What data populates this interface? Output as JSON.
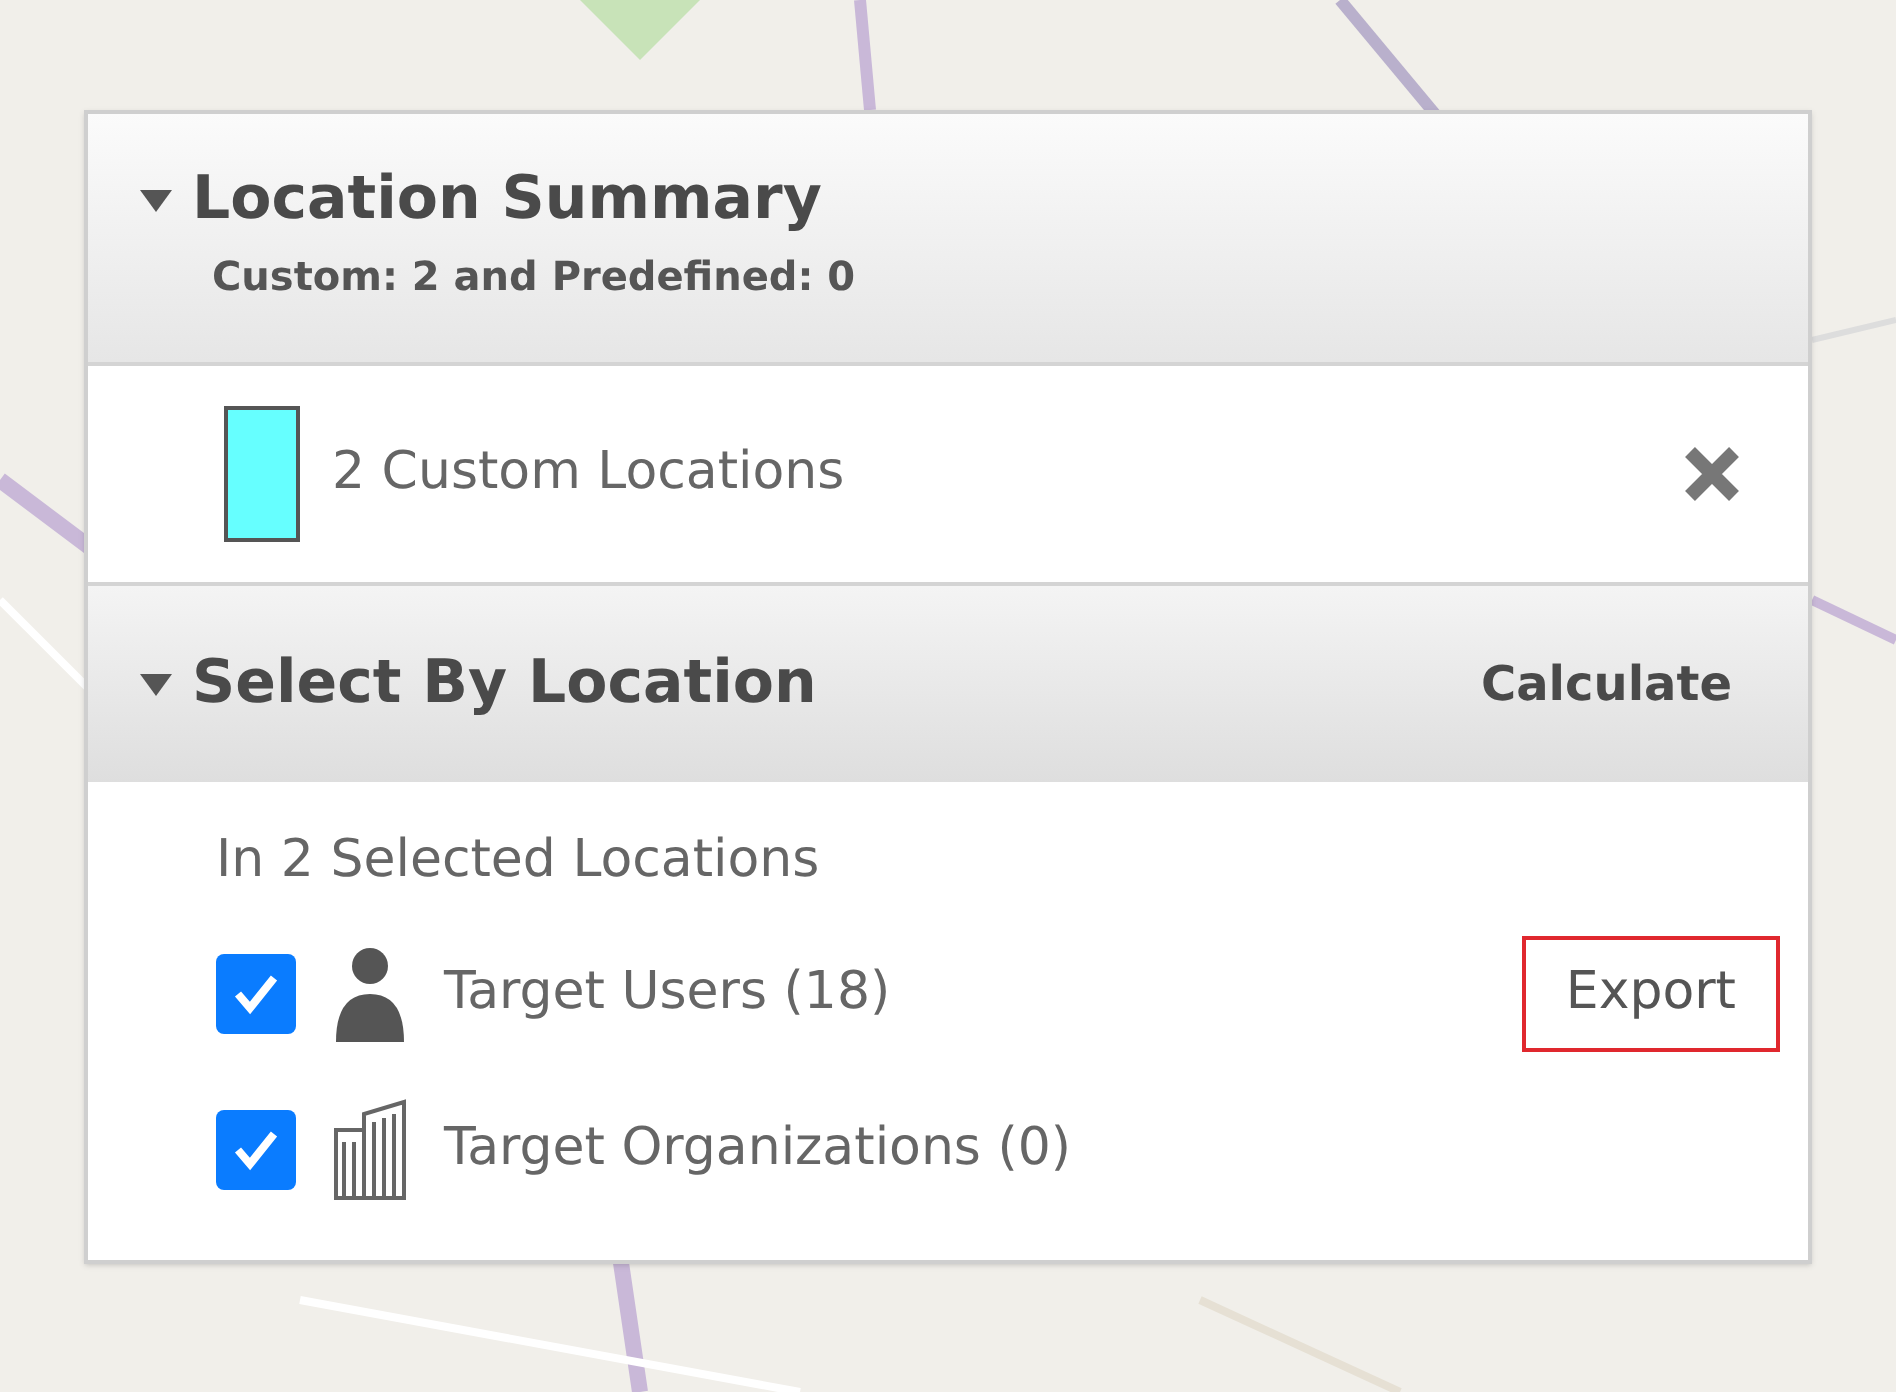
{
  "location_summary": {
    "title": "Location Summary",
    "expanded": true,
    "subtitle": "Custom: 2 and Predefined: 0",
    "items": [
      {
        "label": "2 Custom Locations",
        "color": "#66ffff"
      }
    ]
  },
  "select_by_location": {
    "title": "Select By Location",
    "expanded": true,
    "action": "Calculate",
    "caption": "In 2 Selected Locations",
    "targets": [
      {
        "kind": "user",
        "label": "Target Users (18)",
        "checked": true,
        "export": {
          "label": "Export",
          "highlighted": true
        }
      },
      {
        "kind": "organization",
        "label": "Target Organizations (0)",
        "checked": true
      }
    ]
  }
}
